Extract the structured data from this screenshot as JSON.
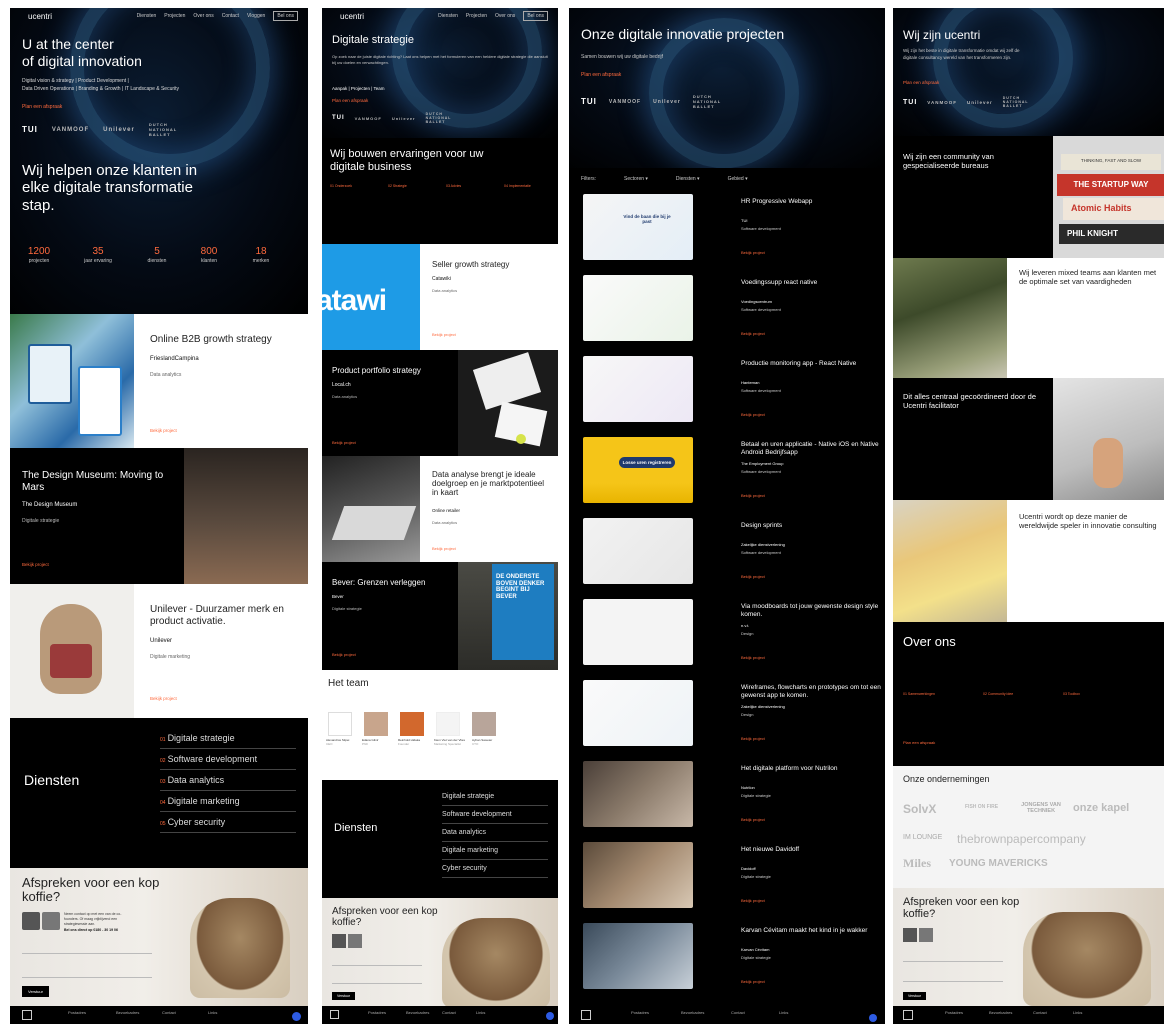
{
  "nav": {
    "logo": "ucentri",
    "items": [
      "Diensten",
      "Projecten",
      "Over ons",
      "Contact",
      "Vloggen"
    ],
    "cta": "Bel ons"
  },
  "p1": {
    "hero_title_line1": "U at the center",
    "hero_title_line2": "of digital innovation",
    "hero_sub1": "Digital vision & strategy | Product Development |",
    "hero_sub2": "Data Driven Operations | Branding & Growth | IT Landscape & Security",
    "hero_cta": "Plan een afspraak",
    "clients": [
      "TUI",
      "VANMOOF",
      "Unilever",
      "DUTCH NATIONAL BALLET"
    ],
    "tagline": "Wij helpen onze klanten in elke digitale transformatie stap.",
    "stats": [
      {
        "value": "1200",
        "label": "projecten"
      },
      {
        "value": "35",
        "label": "jaar ervaring"
      },
      {
        "value": "5",
        "label": "diensten"
      },
      {
        "value": "800",
        "label": "klanten"
      },
      {
        "value": "18",
        "label": "merken"
      }
    ],
    "cases": [
      {
        "title": "Online B2B growth strategy",
        "client": "FrieslandCampina",
        "category": "Data analytics",
        "link": "Bekijk project"
      },
      {
        "title": "The Design Museum: Moving to Mars",
        "client": "The Design Museum",
        "category": "Digitale strategie",
        "link": "Bekijk project"
      },
      {
        "title": "Unilever - Duurzamer merk en product activatie.",
        "client": "Unilever",
        "category": "Digitale marketing",
        "link": "Bekijk project"
      }
    ],
    "diensten_title": "Diensten",
    "diensten": [
      {
        "n": "01",
        "label": "Digitale strategie"
      },
      {
        "n": "02",
        "label": "Software development"
      },
      {
        "n": "03",
        "label": "Data analytics"
      },
      {
        "n": "04",
        "label": "Digitale marketing"
      },
      {
        "n": "05",
        "label": "Cyber security"
      }
    ],
    "coffee_title": "Afspreken voor een kop koffie?",
    "coffee_text": "Neem contact op met een van de co-founders. Of maag vrijblijvend een strategiesessie aan.",
    "coffee_phone": "Bel ons direct op 0180 - 30 19 06",
    "form_cta": "Verstuur",
    "footer_cols": [
      "Postadres",
      "Bezoekadres",
      "Contact",
      "Links"
    ]
  },
  "p2": {
    "hero_title": "Digitale strategie",
    "hero_text": "Op zoek naar de juiste digitale richting? Laat ons helpen met het formuleren van een heldere digitale strategie die aansluit bij uw doelen en verwachtingen.",
    "hero_links": "Aanpak | Projecten | Team",
    "hero_cta": "Plan een afspraak",
    "section_title": "Wij bouwen ervaringen voor uw digitale business",
    "cols": [
      "01 Onderzoek",
      "02 Strategie",
      "03 Advies",
      "04 Implementatie"
    ],
    "cases": [
      {
        "title": "Seller growth strategy",
        "client": "Catawiki",
        "category": "Data analytics",
        "link": "Bekijk project"
      },
      {
        "title": "Product portfolio strategy",
        "client": "Local.ch",
        "category": "Data analytics",
        "link": "Bekijk project"
      },
      {
        "title": "Data analyse brengt je ideale doelgroep en je marktpotentieel in kaart",
        "client": "Online retailer",
        "category": "Data analytics",
        "link": "Bekijk project"
      },
      {
        "title": "Bever: Grenzen verleggen",
        "client": "Bever",
        "category": "Digitale strategie",
        "link": "Bekijk project"
      }
    ],
    "bever_ad": "DE ONDERSTE BOVEN DENKER BEGINT BIJ BEVER",
    "team_title": "Het team",
    "team": [
      {
        "name": "Alexandros Stipei",
        "role": "CEO"
      },
      {
        "name": "Edana Gilnir",
        "role": "PhD"
      },
      {
        "name": "Reinhold Hidaka",
        "role": "Founder"
      },
      {
        "name": "Kiem Viet van der Vlies",
        "role": "Marketing Specialist"
      },
      {
        "name": "Ayhan Sweeter",
        "role": "CTO"
      }
    ],
    "diensten_title": "Diensten",
    "diensten": [
      "Digitale strategie",
      "Software development",
      "Data analytics",
      "Digitale marketing",
      "Cyber security"
    ],
    "coffee_title": "Afspreken voor een kop koffie?"
  },
  "p3": {
    "hero_title": "Onze digitale innovatie projecten",
    "hero_sub": "Samen bouwen wij uw digitale bedrijf",
    "hero_cta": "Plan een afspraak",
    "filters_label": "Filters:",
    "filters": [
      "Sectoren",
      "Diensten",
      "Gebied"
    ],
    "projects": [
      {
        "title": "HR Progressive Webapp",
        "client": "TUI",
        "category": "Software development",
        "link": "Bekijk project",
        "thumb": "Vind de baan die bij je past"
      },
      {
        "title": "Voedingssupp react native",
        "client": "Voedingscentrum",
        "category": "Software development",
        "link": "Bekijk project",
        "thumb": ""
      },
      {
        "title": "Productie monitoring app - React Native",
        "client": "Hanteman",
        "category": "Software development",
        "link": "Bekijk project",
        "thumb": ""
      },
      {
        "title": "Betaal en uren applicatie - Native iOS en Native Android Bedrijfsapp",
        "client": "The Employment Group",
        "category": "Software development",
        "link": "Bekijk project",
        "thumb": "Losse uren registreren"
      },
      {
        "title": "Design sprints",
        "client": "Zakelijke dienstverlening",
        "category": "Software development",
        "link": "Bekijk project",
        "thumb": ""
      },
      {
        "title": "Via moodboards tot jouw gewenste design style komen.",
        "client": "n.v.t.",
        "category": "Design",
        "link": "Bekijk project",
        "thumb": ""
      },
      {
        "title": "Wireframes, flowcharts en prototypes om tot een gewenst app te komen.",
        "client": "Zakelijke dienstverlening",
        "category": "Design",
        "link": "Bekijk project",
        "thumb": ""
      },
      {
        "title": "Het digitale platform voor Nutrilon",
        "client": "Nutrilon",
        "category": "Digitale strategie",
        "link": "Bekijk project",
        "thumb": ""
      },
      {
        "title": "Het nieuwe Davidoff",
        "client": "Davidoff",
        "category": "Digitale strategie",
        "link": "Bekijk project",
        "thumb": ""
      },
      {
        "title": "Karvan Cévitam maakt het kind in je wakker",
        "client": "Karvan Cévitam",
        "category": "Digitale strategie",
        "link": "Bekijk project",
        "thumb": ""
      }
    ],
    "footer_cols": [
      "Postadres",
      "Bezoekadres",
      "Contact",
      "Links"
    ]
  },
  "p4": {
    "hero_title": "Wij zijn ucentri",
    "hero_text": "Wij zijn het beste in digitale transformatie omdat wij zelf de digitale consultancy wereld van het transformeren zijn.",
    "hero_cta": "Plan een afspraak",
    "blocks": [
      {
        "title": "Wij zijn een community van gespecialiseerde bureaus",
        "books": [
          "THINKING, FAST AND SLOW",
          "THE STARTUP WAY",
          "Atomic Habits",
          "PHIL KNIGHT"
        ]
      },
      {
        "title": "Wij leveren mixed teams aan klanten met de optimale set van vaardigheden"
      },
      {
        "title": "Dit alles centraal gecoördineerd door de Ucentri facilitator"
      },
      {
        "title": "Ucentri wordt op deze manier de wereldwijde speler in innovatie consulting"
      }
    ],
    "over_title": "Over ons",
    "over_cols": [
      "01 Samenwerkingen",
      "02 Community idee",
      "03 Toolbox"
    ],
    "over_cta": "Plan een afspraak",
    "ondernemingen_title": "Onze ondernemingen",
    "logos": [
      "SolvX",
      "FISH ON FIRE",
      "JONGENS VAN TECHNIEK",
      "onze kapel",
      "IM LOUNGE",
      "thebrownpapercompany",
      "Miles",
      "YOUNG MAVERICKS"
    ],
    "coffee_title": "Afspreken voor een kop koffie?",
    "form_cta": "Verstuur"
  },
  "colors": {
    "accent": "#ff6a3d",
    "bg": "#000000",
    "panel_white": "#ffffff"
  }
}
